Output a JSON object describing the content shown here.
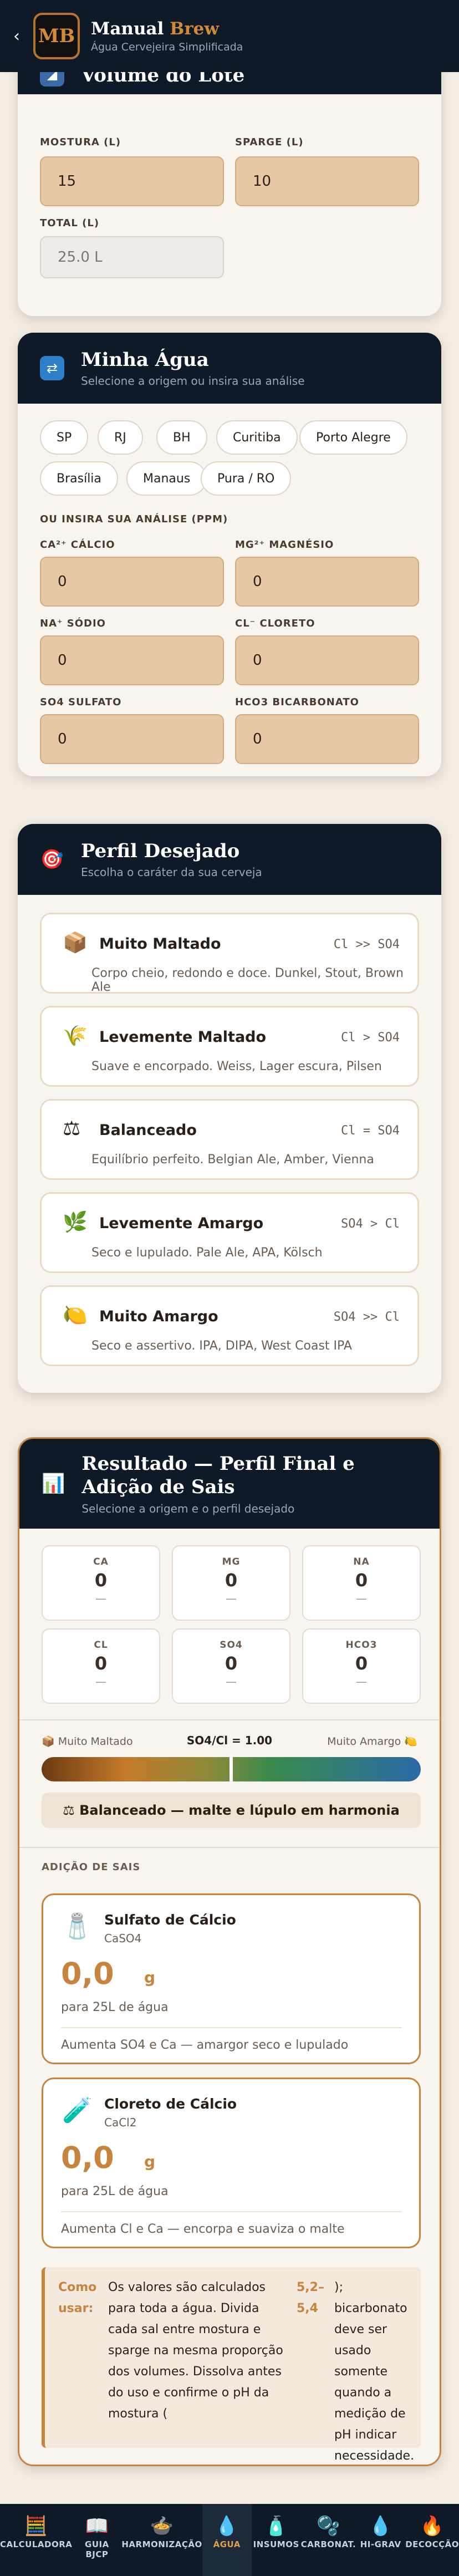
{
  "header": {
    "title_main": "Manual",
    "title_accent": "Brew",
    "subtitle": "Água Cervejeira Simplificada",
    "logo_text": "MB"
  },
  "volume": {
    "title": "Volume do Lote",
    "mostura_label": "MOSTURA (L)",
    "mostura_value": "15",
    "sparge_label": "SPARGE (L)",
    "sparge_value": "10",
    "total_label": "TOTAL (L)",
    "total_value": "25.0 L"
  },
  "water": {
    "title": "Minha Água",
    "subtitle": "Selecione a origem ou insira sua análise",
    "chips": [
      "SP",
      "RJ",
      "BH",
      "Curitiba",
      "Porto Alegre",
      "Brasília",
      "Manaus",
      "Pura / RO"
    ],
    "manual_label": "OU INSIRA SUA ANÁLISE (PPM)",
    "fields": [
      {
        "label": "CA²⁺ CÁLCIO",
        "value": "0"
      },
      {
        "label": "MG²⁺ MAGNÉSIO",
        "value": "0"
      },
      {
        "label": "NA⁺ SÓDIO",
        "value": "0"
      },
      {
        "label": "CL⁻ CLORETO",
        "value": "0"
      },
      {
        "label": "SO4 SULFATO",
        "value": "0"
      },
      {
        "label": "HCO3 BICARBONATO",
        "value": "0"
      }
    ]
  },
  "profile": {
    "title": "Perfil Desejado",
    "subtitle": "Escolha o caráter da sua cerveja",
    "options": [
      {
        "icon": "📦",
        "name": "Muito Maltado",
        "ratio": "Cl >> SO4",
        "desc": "Corpo cheio, redondo e doce. Dunkel, Stout, Brown Ale"
      },
      {
        "icon": "🌾",
        "name": "Levemente Maltado",
        "ratio": "Cl > SO4",
        "desc": "Suave e encorpado. Weiss, Lager escura, Pilsen"
      },
      {
        "icon": "⚖",
        "name": "Balanceado",
        "ratio": "Cl = SO4",
        "desc": "Equilíbrio perfeito. Belgian Ale, Amber, Vienna"
      },
      {
        "icon": "🌿",
        "name": "Levemente Amargo",
        "ratio": "SO4 > Cl",
        "desc": "Seco e lupulado. Pale Ale, APA, Kölsch"
      },
      {
        "icon": "🍋",
        "name": "Muito Amargo",
        "ratio": "SO4 >> Cl",
        "desc": "Seco e assertivo. IPA, DIPA, West Coast IPA"
      }
    ]
  },
  "result": {
    "title": "Resultado — Perfil Final e Adição de Sais",
    "subtitle": "Selecione a origem e o perfil desejado",
    "ions": [
      {
        "name": "CA",
        "value": "0",
        "dash": "—"
      },
      {
        "name": "MG",
        "value": "0",
        "dash": "—"
      },
      {
        "name": "NA",
        "value": "0",
        "dash": "—"
      },
      {
        "name": "CL",
        "value": "0",
        "dash": "—"
      },
      {
        "name": "SO4",
        "value": "0",
        "dash": "—"
      },
      {
        "name": "HCO3",
        "value": "0",
        "dash": "—"
      }
    ],
    "scale_left": "📦 Muito Maltado",
    "scale_ratio": "SO4/Cl = 1.00",
    "scale_right": "Muito Amargo 🍋",
    "scale_position": 0.5,
    "balance_label": "⚖ Balanceado — malte e lúpulo em harmonia",
    "salts_header": "ADIÇÃO DE SAIS",
    "salts": [
      {
        "icon": "🧂",
        "name": "Sulfato de Cálcio",
        "formula": "CaSO4",
        "amount": "0,0",
        "unit": "g",
        "per": "para 25L de água",
        "note": "Aumenta SO4 e Ca — amargor seco e lupulado"
      },
      {
        "icon": "🧪",
        "name": "Cloreto de Cálcio",
        "formula": "CaCl2",
        "amount": "0,0",
        "unit": "g",
        "per": "para 25L de água",
        "note": "Aumenta Cl e Ca — encorpa e suaviza o malte"
      }
    ],
    "howto_label": "Como usar:",
    "howto_text": "Os valores são calculados para toda a água. Divida cada sal entre mostura e sparge na mesma proporção dos volumes. Dissolva antes do uso e confirme o pH da mostura (",
    "howto_ph": "5,2–5,4",
    "howto_tail": "); bicarbonato deve ser usado somente quando a medição de pH indicar necessidade."
  },
  "tabs": [
    {
      "icon": "🧮",
      "label": "CALCULADORA",
      "active": false
    },
    {
      "icon": "📖",
      "label": "GUIA BJCP",
      "active": false
    },
    {
      "icon": "🍲",
      "label": "HARMONIZAÇÃO",
      "active": false
    },
    {
      "icon": "💧",
      "label": "ÁGUA",
      "active": true
    },
    {
      "icon": "🧴",
      "label": "INSUMOS",
      "active": false
    },
    {
      "icon": "🫧",
      "label": "CARBONAT.",
      "active": false
    },
    {
      "icon": "💧",
      "label": "HI-GRAV",
      "active": false
    },
    {
      "icon": "🔥",
      "label": "DECOCÇÃO",
      "active": false
    }
  ],
  "colors": {
    "accent": "#c7843f",
    "navy": "#0e1a28",
    "input": "#e8c7a4"
  }
}
